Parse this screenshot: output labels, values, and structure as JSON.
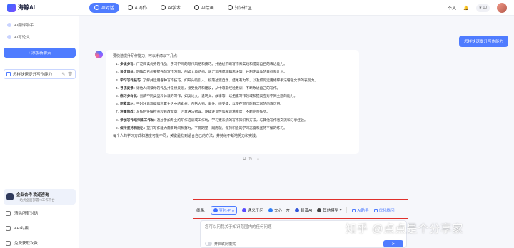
{
  "app": {
    "logo_text": "海鲸AI"
  },
  "nav": {
    "items": [
      {
        "label": "AI对话",
        "icon": "chat-icon",
        "active": true
      },
      {
        "label": "AI写作",
        "icon": "pen-icon",
        "active": false
      },
      {
        "label": "AI学术",
        "icon": "academic-icon",
        "active": false
      },
      {
        "label": "AI绘画",
        "icon": "paint-icon",
        "active": false
      },
      {
        "label": "知识社区",
        "icon": "community-icon",
        "active": false
      }
    ]
  },
  "top_right": {
    "personal": "个人",
    "points": "10",
    "notification_icon": "bell-icon"
  },
  "sidebar": {
    "apps": [
      {
        "label": "AI翻译助手",
        "icon": "translate-icon"
      },
      {
        "label": "AI写论文",
        "icon": "paper-icon"
      }
    ],
    "new_chat_label": "+ 添加新聊天",
    "chat_items": [
      {
        "label": "怎样快速提升写作能力"
      }
    ],
    "promo": {
      "title": "企业合作 欢迎咨询",
      "subtitle": "一站式全面部署AI工作平台"
    },
    "footer": [
      {
        "label": "清除所有对话",
        "icon": "trash-icon"
      },
      {
        "label": "API对接",
        "icon": "api-icon"
      },
      {
        "label": "免费获取次数",
        "icon": "gift-icon"
      }
    ]
  },
  "conversation": {
    "user_message": "怎样快速提升写作能力",
    "answer": {
      "intro": "要快速提升写作能力，可以考虑以下几点：",
      "points": [
        {
          "num": "1.",
          "title": "多读多写:",
          "text": "广泛阅读优秀的作品，学习不同的写作风格和技巧。并通过不断写作来实践和提高自己的表达能力。"
        },
        {
          "num": "2.",
          "title": "设定目标:",
          "text": "明确自己想要提升的写作方面，例如文章结构、词汇运用或逻辑思维等，并制定具体的目标和计划。"
        },
        {
          "num": "3.",
          "title": "学习写作技巧:",
          "text": "了解并运用各种写作技巧，如开头吸引人、段落过渡自然、结尾有力等，以及如何运用修辞手法增强文章的表现力。"
        },
        {
          "num": "4.",
          "title": "寻求反馈:",
          "text": "请他人阅读你的作品并提供反馈，接受批评和建议，从中吸取经验教训，不断改进自己的写作。"
        },
        {
          "num": "5.",
          "title": "练习多样化:",
          "text": "尝试不同类型和体裁的写作，如议论文、说明文、故事等，以拓宽写作领域和提高应对不同主题的能力。"
        },
        {
          "num": "6.",
          "title": "积累素材:",
          "text": "平时注意观察和积累生活中的素材，包括人物、事件、感受等，以便在写作时有丰富的内容可用。"
        },
        {
          "num": "7.",
          "title": "注重修改:",
          "text": "写作后仔细检查和修改文章，注意语法错误、逻辑连贯性和表达清晰度，不断完善作品。"
        },
        {
          "num": "8.",
          "title": "参加写作培训或工作坊:",
          "text": "通过参加专业的写作培训或工作坊，学习更系统的写作知识和方法，与其他写作者交流和分享经验。"
        },
        {
          "num": "9.",
          "title": "保持坚持和耐心:",
          "text": "提升写作能力需要时间和努力，不要期望一蹴而就，保持积极的学习态度和坚持不懈的练习。"
        }
      ],
      "outro": "每个人的学习方式和进度可能不同，关键是找到适合自己的方法，并持续不断地努力和实践。"
    }
  },
  "model_bar": {
    "label": "线路:",
    "models": [
      {
        "label": "豆包-Pro",
        "color": "#3d6bff",
        "active": true
      },
      {
        "label": "通义千问",
        "color": "#5b4cff",
        "active": false
      },
      {
        "label": "文心一言",
        "color": "#2f7df6",
        "active": false
      },
      {
        "label": "智谱AI",
        "color": "#3456d8",
        "active": false
      },
      {
        "label": "其他模型",
        "color": "#444444",
        "active": false
      }
    ],
    "links": [
      {
        "label": "AI助手"
      },
      {
        "label": "优化提问"
      }
    ]
  },
  "input": {
    "placeholder": "您可以问我关于知识范围内的任何问题",
    "toggle_label": "开启联网模式",
    "send_icon": "send-icon"
  },
  "watermark": "知乎 @点点是个分享家"
}
